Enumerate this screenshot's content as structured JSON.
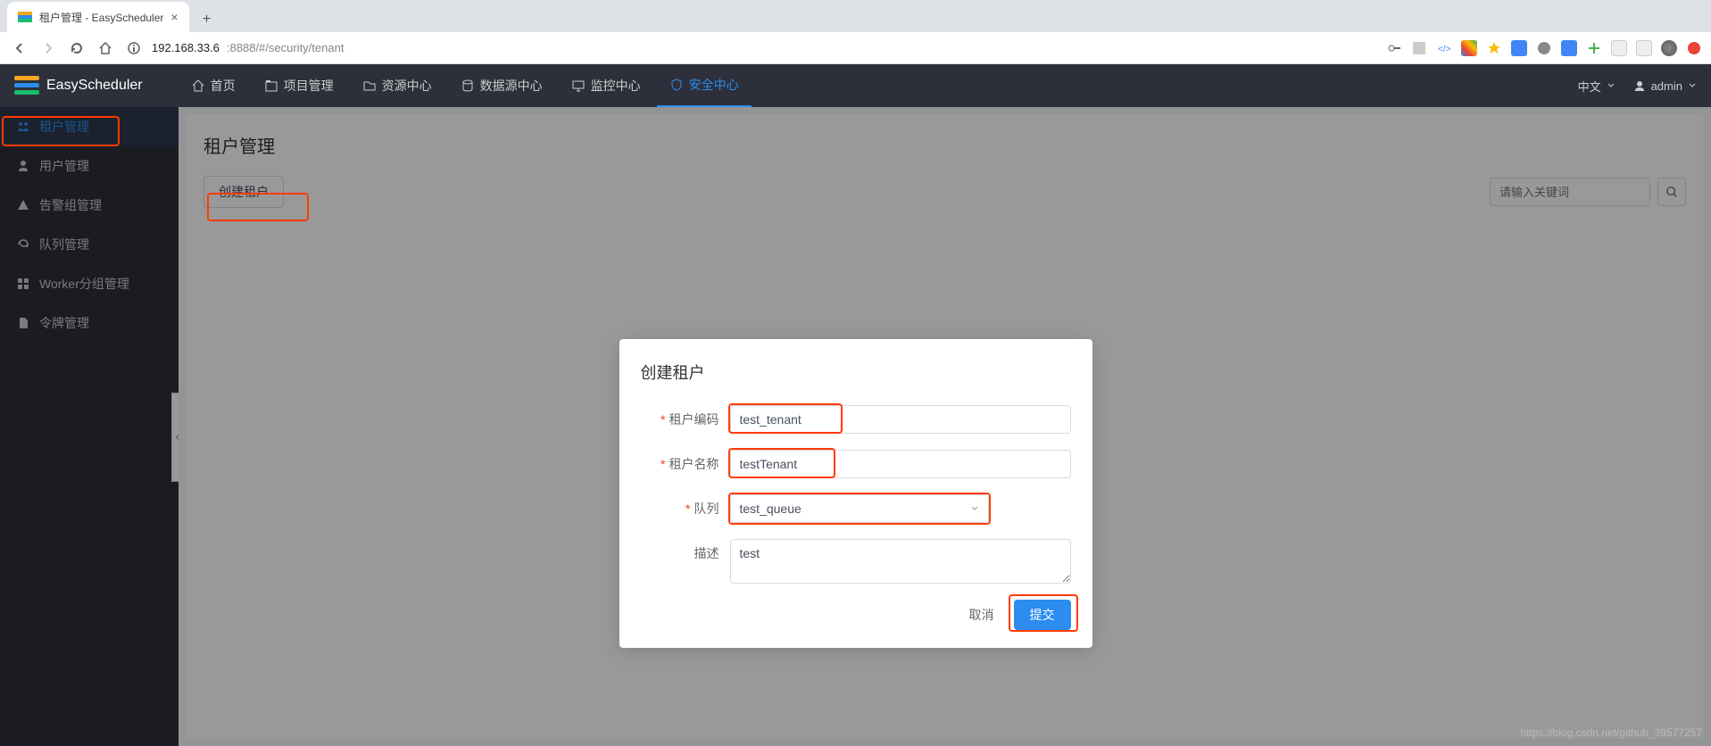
{
  "browser": {
    "tab_title": "租户管理 - EasyScheduler",
    "url_host": "192.168.33.6",
    "url_port_path": ":8888/#/security/tenant"
  },
  "header": {
    "app_name": "EasyScheduler",
    "nav": [
      {
        "label": "首页",
        "icon": "home"
      },
      {
        "label": "项目管理",
        "icon": "project"
      },
      {
        "label": "资源中心",
        "icon": "folder"
      },
      {
        "label": "数据源中心",
        "icon": "database"
      },
      {
        "label": "监控中心",
        "icon": "monitor"
      },
      {
        "label": "安全中心",
        "icon": "shield",
        "active": true
      }
    ],
    "lang": "中文",
    "user": "admin"
  },
  "sidebar": {
    "items": [
      {
        "label": "租户管理",
        "active": true
      },
      {
        "label": "用户管理"
      },
      {
        "label": "告警组管理"
      },
      {
        "label": "队列管理"
      },
      {
        "label": "Worker分组管理"
      },
      {
        "label": "令牌管理"
      }
    ]
  },
  "page": {
    "title": "租户管理",
    "create_btn": "创建租户",
    "search_placeholder": "请输入关键词"
  },
  "modal": {
    "title": "创建租户",
    "fields": {
      "code_label": "租户编码",
      "code_value": "test_tenant",
      "name_label": "租户名称",
      "name_value": "testTenant",
      "queue_label": "队列",
      "queue_value": "test_queue",
      "desc_label": "描述",
      "desc_value": "test"
    },
    "cancel": "取消",
    "submit": "提交"
  },
  "watermark": "https://blog.csdn.net/github_39577257"
}
